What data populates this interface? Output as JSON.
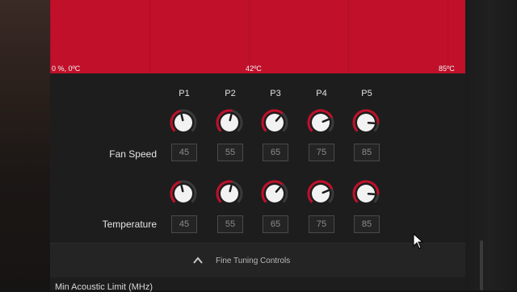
{
  "graph": {
    "label_left": "0 %, 0ºC",
    "label_mid": "42ºC",
    "label_right": "85ºC",
    "fill_color": "#c0102a"
  },
  "points": {
    "columns": [
      "P1",
      "P2",
      "P3",
      "P4",
      "P5"
    ]
  },
  "fan_speed": {
    "label": "Fan Speed",
    "values": [
      "45",
      "55",
      "65",
      "75",
      "85"
    ]
  },
  "temperature": {
    "label": "Temperature",
    "values": [
      "45",
      "55",
      "65",
      "75",
      "85"
    ]
  },
  "fine_tuning": {
    "label": "Fine Tuning Controls"
  },
  "next_section": {
    "label": "Min Acoustic Limit (MHz)"
  },
  "colors": {
    "accent": "#c0102a",
    "knob_track": "#3a3a3a",
    "knob_face": "#f2f2f2"
  },
  "icons": {
    "fine_tuning": "chevron-up-icon",
    "cursor": "mouse-pointer-icon"
  }
}
